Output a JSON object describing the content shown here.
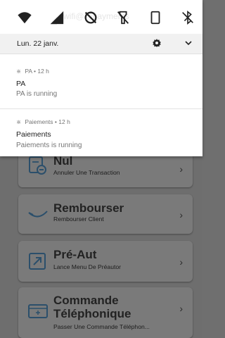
{
  "status_bar": {
    "ghost_text": "wifi@@payments"
  },
  "notification_header": {
    "date": "Lun. 22 janv."
  },
  "notifications": [
    {
      "app": "PA",
      "time": "12 h",
      "title": "PA",
      "body": "PA is running"
    },
    {
      "app": "Paiements",
      "time": "12 h",
      "title": "Paiements",
      "body": "Paiements is running"
    }
  ],
  "cards": [
    {
      "title": "Nul",
      "subtitle": "Annuler Une Transaction",
      "icon": "cancel-transaction-icon"
    },
    {
      "title": "Rembourser",
      "subtitle": "Rembourser Client",
      "icon": "refund-icon"
    },
    {
      "title": "Pré-Aut",
      "subtitle": "Lance Menu De Préautor",
      "icon": "preauth-icon"
    },
    {
      "title_line1": "Commande",
      "title_line2": "Téléphonique",
      "subtitle": "Passer Une Commande Téléphon...",
      "icon": "phone-order-icon"
    }
  ],
  "colors": {
    "shade_bg": "#ffffff",
    "header_bg": "#f1f1f1",
    "dimmed_bg": "#6e6e6e",
    "card_bg": "#7a7a7a",
    "icon_accent": "#2b4f6b"
  }
}
